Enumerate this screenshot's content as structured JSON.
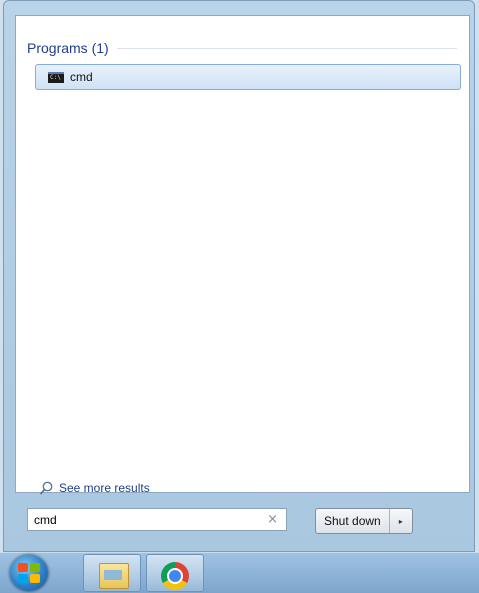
{
  "start_menu": {
    "section": {
      "title": "Programs (1)"
    },
    "results": [
      {
        "label": "cmd",
        "icon": "cmd-icon"
      }
    ],
    "see_more": {
      "label": "See more results",
      "icon": "search-icon"
    },
    "search": {
      "value": "cmd",
      "clear_icon": "×"
    },
    "shutdown": {
      "label": "Shut down",
      "arrow": "▸"
    }
  },
  "taskbar": {
    "items": [
      {
        "icon": "windows-start-orb-icon"
      },
      {
        "icon": "folder-icon"
      },
      {
        "icon": "chrome-icon"
      }
    ]
  }
}
